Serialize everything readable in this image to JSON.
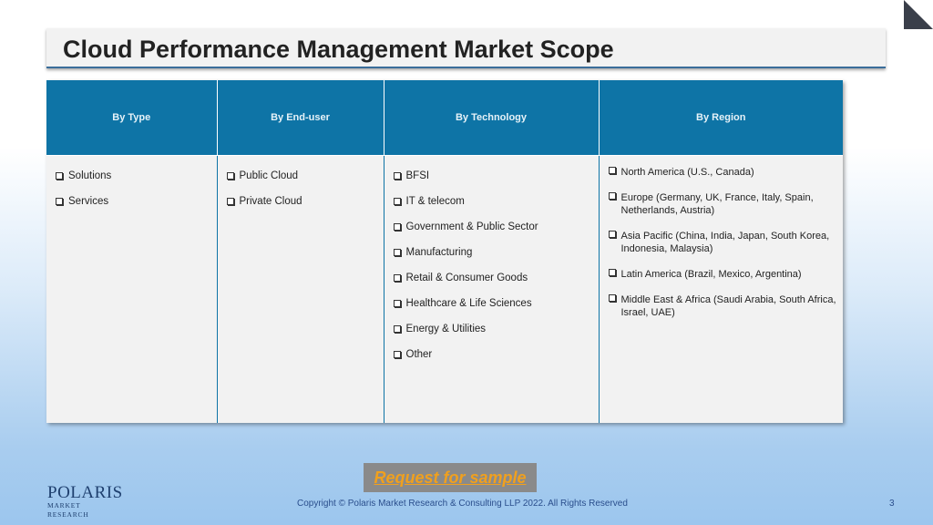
{
  "title": "Cloud Performance Management Market Scope",
  "columns": [
    {
      "header": "By Type",
      "items": [
        "Solutions",
        "Services"
      ]
    },
    {
      "header": "By End-user",
      "items": [
        "Public Cloud",
        "Private Cloud"
      ]
    },
    {
      "header": "By Technology",
      "items": [
        "BFSI",
        "IT & telecom",
        "Government & Public Sector",
        "Manufacturing",
        "Retail & Consumer Goods",
        "Healthcare & Life Sciences",
        "Energy & Utilities",
        "Other"
      ]
    },
    {
      "header": "By Region",
      "items": [
        "North America (U.S., Canada)",
        "Europe (Germany, UK, France, Italy, Spain, Netherlands, Austria)",
        "Asia Pacific (China, India, Japan, South Korea, Indonesia, Malaysia)",
        "Latin America (Brazil, Mexico, Argentina)",
        "Middle East & Africa (Saudi Arabia, South Africa, Israel, UAE)"
      ]
    }
  ],
  "request_button": "Request for sample",
  "logo": {
    "name": "POLARIS",
    "subtitle": "MARKET RESEARCH"
  },
  "copyright": "Copyright © Polaris Market Research & Consulting LLP 2022. All Rights Reserved",
  "page_number": "3",
  "colors": {
    "header_bg": "#0e74a6",
    "accent_orange": "#f0a01e",
    "logo_navy": "#1e3f6e"
  }
}
